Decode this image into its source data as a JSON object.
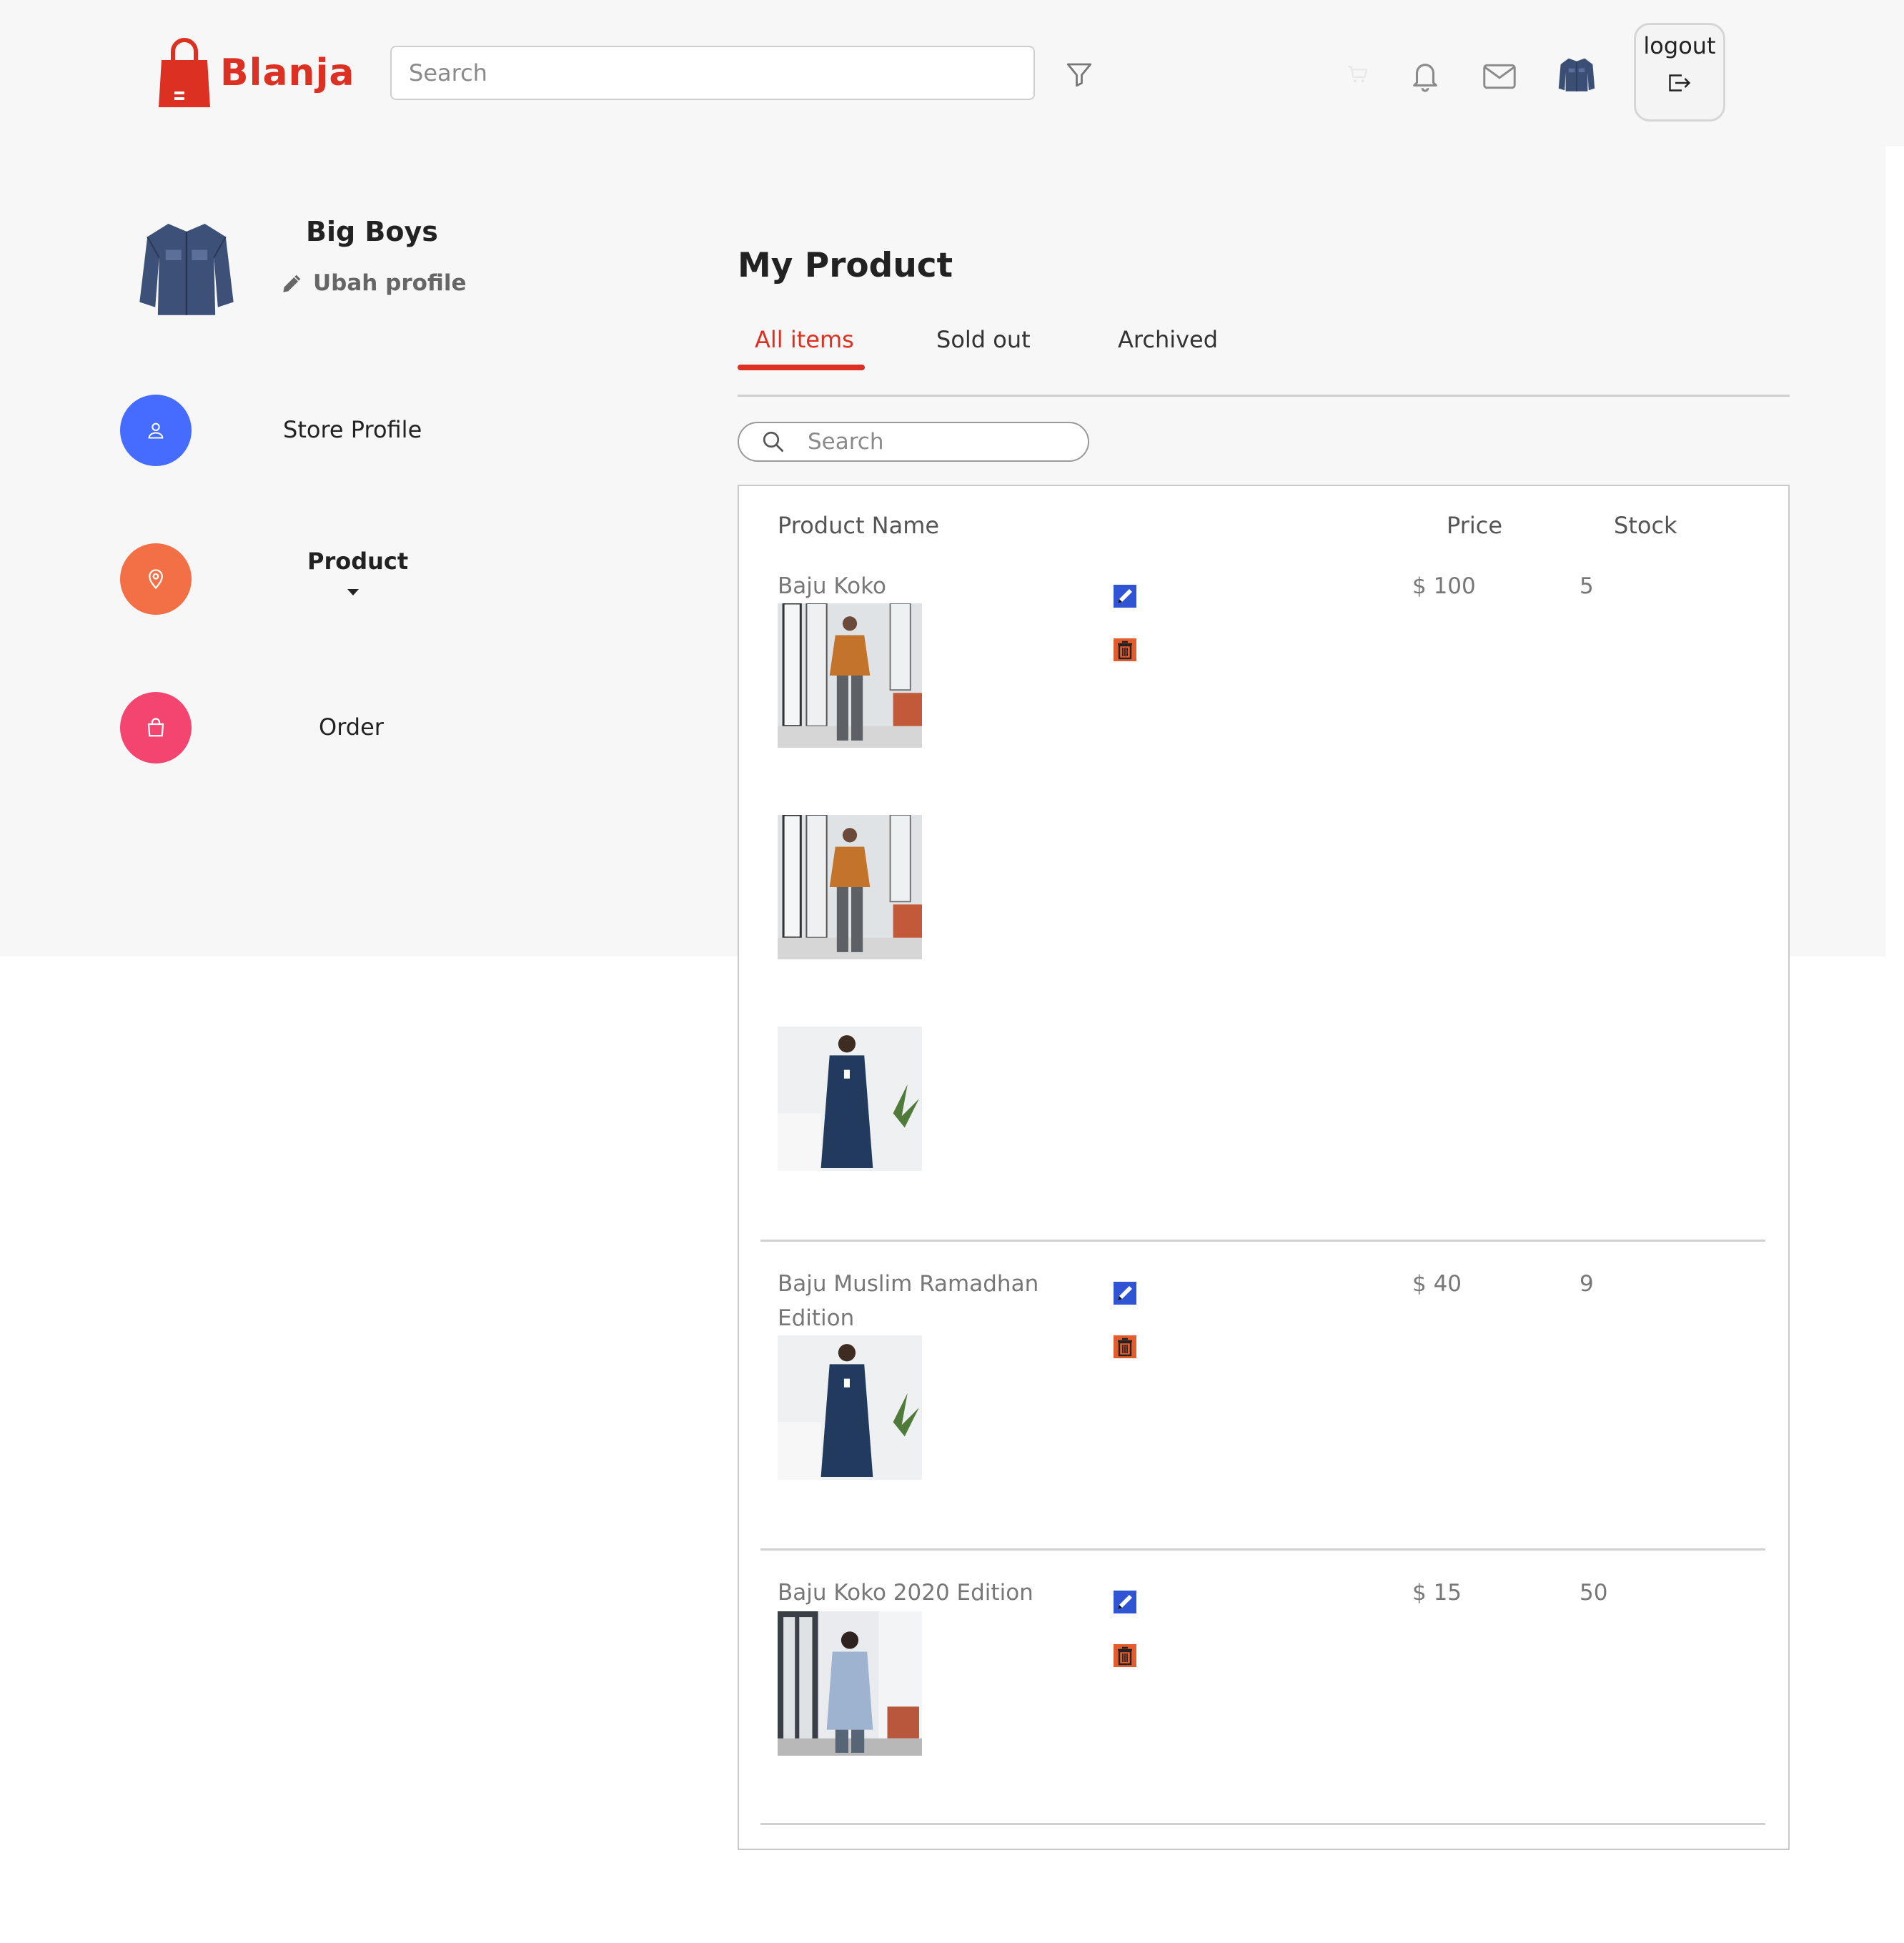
{
  "header": {
    "brand": "Blanja",
    "search_placeholder": "Search",
    "logout_label": "logout"
  },
  "sidebar": {
    "store_name": "Big Boys",
    "edit_profile": "Ubah profile",
    "items": [
      {
        "label": "Store Profile",
        "icon": "user-icon",
        "color": "#456bff"
      },
      {
        "label": "Product",
        "icon": "location-pin-icon",
        "color": "#f36f45"
      },
      {
        "label": "Order",
        "icon": "shopping-bag-icon",
        "color": "#f3456f"
      }
    ]
  },
  "main": {
    "title": "My Product",
    "tabs": [
      {
        "label": "All items",
        "active": true
      },
      {
        "label": "Sold out",
        "active": false
      },
      {
        "label": "Archived",
        "active": false
      }
    ],
    "search_placeholder": "Search",
    "table": {
      "headers": {
        "name": "Product Name",
        "price": "Price",
        "stock": "Stock"
      },
      "rows": [
        {
          "name": "Baju Koko",
          "price": "$ 100",
          "stock": "5",
          "images": [
            "orange-shirt",
            "orange-shirt",
            "navy-shirt"
          ]
        },
        {
          "name": "Baju Muslim Ramadhan Edition",
          "price": "$ 40",
          "stock": "9",
          "images": [
            "navy-shirt"
          ]
        },
        {
          "name": "Baju Koko 2020 Edition",
          "price": "$ 15",
          "stock": "50",
          "images": [
            "light-blue-shirt"
          ]
        }
      ]
    }
  },
  "colors": {
    "brand": "#db3022",
    "edit_icon": "#2f55d4",
    "delete_icon": "#e25c2c"
  }
}
